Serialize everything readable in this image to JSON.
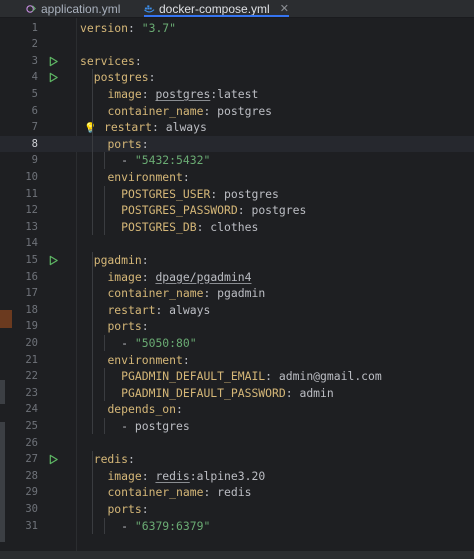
{
  "tabs": [
    {
      "label": "application.yml",
      "icon": "yaml-file-icon",
      "active": false
    },
    {
      "label": "docker-compose.yml",
      "icon": "docker-icon",
      "active": true
    }
  ],
  "colors": {
    "accent": "#3574f0",
    "key": "#d5b778",
    "string": "#6aab73",
    "run": "#5fb865"
  },
  "current_line": 8,
  "lines": [
    {
      "n": "1",
      "i": "",
      "segs": [
        [
          "k",
          "version"
        ],
        [
          "p",
          ": "
        ],
        [
          "s",
          "\"3.7\""
        ]
      ]
    },
    {
      "n": "2",
      "i": "",
      "segs": []
    },
    {
      "n": "3",
      "i": "",
      "segs": [
        [
          "k",
          "services"
        ],
        [
          "p",
          ":"
        ]
      ]
    },
    {
      "n": "4",
      "i": "  ",
      "segs": [
        [
          "k",
          "postgres"
        ],
        [
          "p",
          ":"
        ]
      ]
    },
    {
      "n": "5",
      "i": "    ",
      "segs": [
        [
          "k",
          "image"
        ],
        [
          "p",
          ": "
        ],
        [
          "pu",
          "postgres"
        ],
        [
          "p",
          ":latest"
        ]
      ]
    },
    {
      "n": "6",
      "i": "    ",
      "segs": [
        [
          "k",
          "container_name"
        ],
        [
          "p",
          ": postgres"
        ]
      ]
    },
    {
      "n": "7",
      "i": "    ",
      "segs": [
        [
          "k",
          "restart"
        ],
        [
          "p",
          ": always"
        ]
      ]
    },
    {
      "n": "8",
      "i": "    ",
      "segs": [
        [
          "k",
          "ports"
        ],
        [
          "p",
          ":"
        ]
      ]
    },
    {
      "n": "9",
      "i": "      ",
      "segs": [
        [
          "p",
          "- "
        ],
        [
          "s",
          "\"5432:5432\""
        ]
      ]
    },
    {
      "n": "10",
      "i": "    ",
      "segs": [
        [
          "k",
          "environment"
        ],
        [
          "p",
          ":"
        ]
      ]
    },
    {
      "n": "11",
      "i": "      ",
      "segs": [
        [
          "k",
          "POSTGRES_USER"
        ],
        [
          "p",
          ": postgres"
        ]
      ]
    },
    {
      "n": "12",
      "i": "      ",
      "segs": [
        [
          "k",
          "POSTGRES_PASSWORD"
        ],
        [
          "p",
          ": postgres"
        ]
      ]
    },
    {
      "n": "13",
      "i": "      ",
      "segs": [
        [
          "k",
          "POSTGRES_DB"
        ],
        [
          "p",
          ": clothes"
        ]
      ]
    },
    {
      "n": "14",
      "i": "",
      "segs": []
    },
    {
      "n": "15",
      "i": "  ",
      "segs": [
        [
          "k",
          "pgadmin"
        ],
        [
          "p",
          ":"
        ]
      ]
    },
    {
      "n": "16",
      "i": "    ",
      "segs": [
        [
          "k",
          "image"
        ],
        [
          "p",
          ": "
        ],
        [
          "pu",
          "dpage/pgadmin4"
        ]
      ]
    },
    {
      "n": "17",
      "i": "    ",
      "segs": [
        [
          "k",
          "container_name"
        ],
        [
          "p",
          ": pgadmin"
        ]
      ]
    },
    {
      "n": "18",
      "i": "    ",
      "segs": [
        [
          "k",
          "restart"
        ],
        [
          "p",
          ": always"
        ]
      ]
    },
    {
      "n": "19",
      "i": "    ",
      "segs": [
        [
          "k",
          "ports"
        ],
        [
          "p",
          ":"
        ]
      ]
    },
    {
      "n": "20",
      "i": "      ",
      "segs": [
        [
          "p",
          "- "
        ],
        [
          "s",
          "\"5050:80\""
        ]
      ]
    },
    {
      "n": "21",
      "i": "    ",
      "segs": [
        [
          "k",
          "environment"
        ],
        [
          "p",
          ":"
        ]
      ]
    },
    {
      "n": "22",
      "i": "      ",
      "segs": [
        [
          "k",
          "PGADMIN_DEFAULT_EMAIL"
        ],
        [
          "p",
          ": admin@gmail.com"
        ]
      ]
    },
    {
      "n": "23",
      "i": "      ",
      "segs": [
        [
          "k",
          "PGADMIN_DEFAULT_PASSWORD"
        ],
        [
          "p",
          ": admin"
        ]
      ]
    },
    {
      "n": "24",
      "i": "    ",
      "segs": [
        [
          "k",
          "depends_on"
        ],
        [
          "p",
          ":"
        ]
      ]
    },
    {
      "n": "25",
      "i": "      ",
      "segs": [
        [
          "p",
          "- postgres"
        ]
      ]
    },
    {
      "n": "26",
      "i": "",
      "segs": []
    },
    {
      "n": "27",
      "i": "  ",
      "segs": [
        [
          "k",
          "redis"
        ],
        [
          "p",
          ":"
        ]
      ]
    },
    {
      "n": "28",
      "i": "    ",
      "segs": [
        [
          "k",
          "image"
        ],
        [
          "p",
          ": "
        ],
        [
          "pu",
          "redis"
        ],
        [
          "p",
          ":alpine3.20"
        ]
      ]
    },
    {
      "n": "29",
      "i": "    ",
      "segs": [
        [
          "k",
          "container_name"
        ],
        [
          "p",
          ": redis"
        ]
      ]
    },
    {
      "n": "30",
      "i": "    ",
      "segs": [
        [
          "k",
          "ports"
        ],
        [
          "p",
          ":"
        ]
      ]
    },
    {
      "n": "31",
      "i": "      ",
      "segs": [
        [
          "p",
          "- "
        ],
        [
          "s",
          "\"6379:6379\""
        ]
      ]
    }
  ],
  "run_lines": [
    3,
    4,
    15,
    27
  ],
  "bulb_line": 7
}
